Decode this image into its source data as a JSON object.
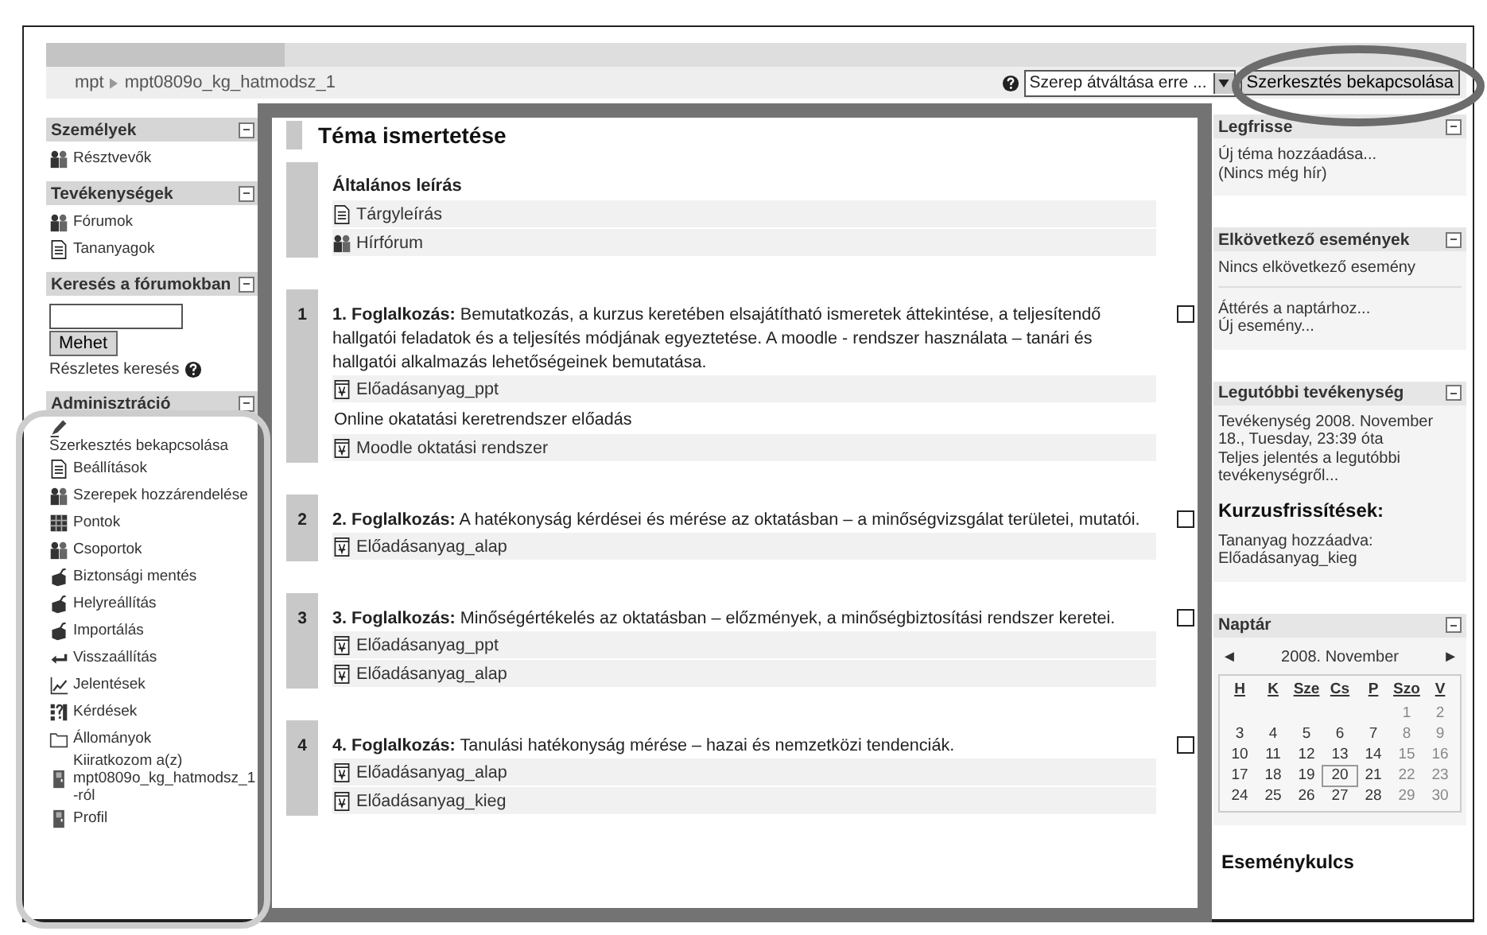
{
  "breadcrumb": [
    "mpt",
    "mpt0809o_kg_hatmodsz_1"
  ],
  "header": {
    "role_select": "Szerep átváltása erre ...",
    "edit_button": "Szerkesztés bekapcsolása"
  },
  "left_blocks": [
    {
      "title": "Személyek",
      "items": [
        {
          "kind": "people",
          "label": "Résztvevők"
        }
      ]
    },
    {
      "title": "Tevékenységek",
      "items": [
        {
          "kind": "people",
          "label": "Fórumok"
        },
        {
          "kind": "document",
          "label": "Tananyagok"
        }
      ]
    },
    {
      "title": "Keresés a fórumokban",
      "search": {
        "button": "Mehet",
        "advanced": "Részletes keresés"
      }
    },
    {
      "title": "Adminisztráció",
      "items": [
        {
          "kind": "edit",
          "label": "Szerkesztés bekapcsolása"
        },
        {
          "kind": "document",
          "label": "Beállítások"
        },
        {
          "kind": "roles",
          "label": "Szerepek hozzárendelése"
        },
        {
          "kind": "grid",
          "label": "Pontok"
        },
        {
          "kind": "people",
          "label": "Csoportok"
        },
        {
          "kind": "box",
          "label": "Biztonsági mentés"
        },
        {
          "kind": "box",
          "label": "Helyreállítás"
        },
        {
          "kind": "box",
          "label": "Importálás"
        },
        {
          "kind": "undo",
          "label": "Visszaállítás"
        },
        {
          "kind": "chart",
          "label": "Jelentések"
        },
        {
          "kind": "questions",
          "label": "Kérdések"
        },
        {
          "kind": "folder",
          "label": "Állományok"
        },
        {
          "kind": "door",
          "label": "Kiiratkozom a(z) mpt0809o_kg_hatmodsz_1 -ról"
        },
        {
          "kind": "door",
          "label": "Profil"
        }
      ]
    }
  ],
  "course": {
    "title": "Téma ismertetése",
    "sections": [
      {
        "title": "Általános leírás",
        "items": [
          {
            "kind": "document",
            "label": "Tárgyleírás"
          },
          {
            "kind": "people",
            "label": "Hírfórum"
          }
        ]
      },
      {
        "number": "1",
        "checked": false,
        "summary": "**1. Foglalkozás:** Bemutatkozás, a kurzus keretében elsajátítható ismeretek áttekintése, a teljesítendő hallgatói feladatok és a teljesítés módjának egyeztetése. A moodle - rendszer használata – tanári és hallgatói alkalmazás lehetőségeinek bemutatása.",
        "items": [
          {
            "kind": "file",
            "label": "Előadásanyag_ppt"
          },
          {
            "kind": "label",
            "label": "Online okatatási keretrendszer előadás"
          },
          {
            "kind": "file",
            "label": "Moodle oktatási rendszer"
          }
        ]
      },
      {
        "number": "2",
        "checked": false,
        "summary": "**2. Foglalkozás:** A hatékonyság kérdései és mérése az oktatásban – a minőségvizsgálat területei, mutatói.",
        "items": [
          {
            "kind": "file",
            "label": "Előadásanyag_alap"
          }
        ]
      },
      {
        "number": "3",
        "checked": false,
        "summary": "**3. Foglalkozás:** Minőségértékelés az oktatásban – előzmények, a minőségbiztosítási rendszer keretei.",
        "items": [
          {
            "kind": "file",
            "label": "Előadásanyag_ppt"
          },
          {
            "kind": "file",
            "label": "Előadásanyag_alap"
          }
        ]
      },
      {
        "number": "4",
        "checked": false,
        "summary": "**4. Foglalkozás:** Tanulási hatékonyság mérése – hazai és nemzetközi tendenciák.",
        "items": [
          {
            "kind": "file",
            "label": "Előadásanyag_alap"
          },
          {
            "kind": "file",
            "label": "Előadásanyag_kieg"
          }
        ]
      }
    ]
  },
  "right_blocks": [
    {
      "title": "Legfrisse",
      "lines": [
        "Új téma hozzáadása...",
        "(Nincs még hír)"
      ]
    },
    {
      "title": "Elkövetkező események",
      "lines": [
        "Nincs elkövetkező esemény"
      ],
      "links": [
        "Áttérés a naptárhoz...",
        "Új esemény..."
      ]
    },
    {
      "title": "Legutóbbi tevékenység",
      "lines": [
        "Tevékenység 2008. November 18., Tuesday, 23:39 óta",
        "Teljes jelentés a legutóbbi tevékenységről..."
      ],
      "subheading": "Kurzusfrissítések:",
      "updates": [
        "Tananyag hozzáadva:",
        "Előadásanyag_kieg"
      ]
    }
  ],
  "calendar": {
    "title": "Naptár",
    "prev": "◄",
    "month": "2008. November",
    "next": "►",
    "weekdays": [
      "H",
      "K",
      "Sze",
      "Cs",
      "P",
      "Szo",
      "V"
    ],
    "weeks": [
      [
        {
          "d": "1",
          "today": false
        },
        {
          "d": "2",
          "today": false
        }
      ],
      [
        {
          "d": "3",
          "today": false
        },
        {
          "d": "4",
          "today": false
        },
        {
          "d": "5",
          "today": false
        },
        {
          "d": "6",
          "today": false
        },
        {
          "d": "7",
          "today": false
        },
        {
          "d": "8",
          "today": false
        },
        {
          "d": "9",
          "today": false
        }
      ],
      [
        {
          "d": "10",
          "today": false
        },
        {
          "d": "11",
          "today": false
        },
        {
          "d": "12",
          "today": false
        },
        {
          "d": "13",
          "today": false
        },
        {
          "d": "14",
          "today": false
        },
        {
          "d": "15",
          "today": false
        },
        {
          "d": "16",
          "today": false
        }
      ],
      [
        {
          "d": "17",
          "today": false
        },
        {
          "d": "18",
          "today": false
        },
        {
          "d": "19",
          "today": false
        },
        {
          "d": "20",
          "today": true
        },
        {
          "d": "21",
          "today": false
        },
        {
          "d": "22",
          "today": false
        },
        {
          "d": "23",
          "today": false
        }
      ],
      [
        {
          "d": "24",
          "today": false
        },
        {
          "d": "25",
          "today": false
        },
        {
          "d": "26",
          "today": false
        },
        {
          "d": "27",
          "today": false
        },
        {
          "d": "28",
          "today": false
        },
        {
          "d": "29",
          "today": false
        },
        {
          "d": "30",
          "today": false
        }
      ]
    ]
  },
  "event_key": {
    "title": "Eseménykulcs"
  }
}
